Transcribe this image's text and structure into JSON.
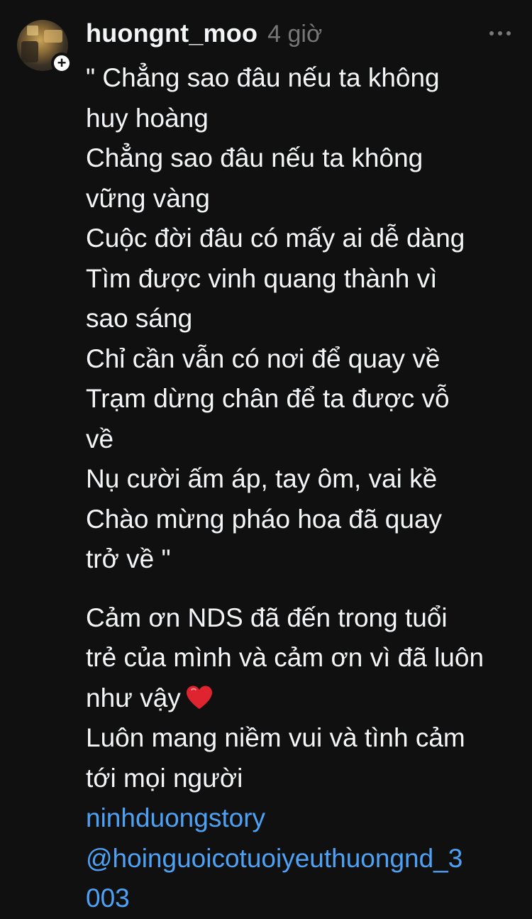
{
  "post": {
    "username": "huongnt_moo",
    "timestamp": "4 giờ",
    "follow_symbol": "+",
    "verse_lines": [
      "\" Chẳng sao đâu nếu ta không",
      "huy hoàng",
      "Chẳng sao đâu nếu ta không",
      "vững vàng",
      "Cuộc đời đâu có mấy ai dễ dàng",
      "Tìm được vinh quang thành vì",
      "sao sáng",
      "Chỉ cần vẫn có nơi để quay về",
      "Trạm dừng chân để ta được vỗ",
      "về",
      "Nụ cười ấm áp, tay ôm, vai kề",
      "Chào mừng pháo hoa đã quay",
      "trở về \""
    ],
    "message_lines": [
      "Cảm ơn NDS đã đến trong tuổi",
      "trẻ của mình và cảm ơn vì đã luôn",
      "như vậy",
      "Luôn mang niềm vui và tình cảm",
      "tới mọi người"
    ],
    "tag_lines": [
      "ninhduongstory",
      "@hoinguoicotuoiyeuthuongnd_3",
      "003"
    ],
    "icons": {
      "more": "more-horizontal-icon",
      "heart": "red-heart-icon",
      "follow": "plus-icon"
    },
    "colors": {
      "background": "#101010",
      "text": "#f3f5f7",
      "muted": "#777777",
      "link": "#4ea2f5",
      "heart": "#e0242f"
    }
  }
}
